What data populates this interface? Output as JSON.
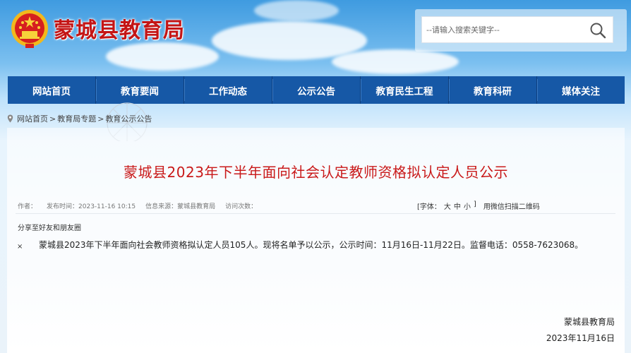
{
  "header": {
    "site_title": "蒙城县教育局",
    "logo_icon": "national-emblem-icon",
    "search": {
      "placeholder": "--请输入搜索关键字--",
      "button_icon": "search-icon"
    }
  },
  "nav": {
    "items": [
      {
        "label": "网站首页"
      },
      {
        "label": "教育要闻"
      },
      {
        "label": "工作动态"
      },
      {
        "label": "公示公告"
      },
      {
        "label": "教育民生工程"
      },
      {
        "label": "教育科研"
      },
      {
        "label": "媒体关注"
      }
    ],
    "bg_color": "#1658a6"
  },
  "breadcrumb": {
    "icon": "location-pin-icon",
    "items": [
      "网站首页",
      "教育局专题",
      "教育公示公告"
    ],
    "separator": ">"
  },
  "article": {
    "title": "蒙城县2023年下半年面向社会认定教师资格拟认定人员公示",
    "title_color": "#c91919",
    "meta": {
      "author": "作者：",
      "publish_time": "发布时间：2023-11-16 10:15",
      "source": "信息来源：蒙城县教育局",
      "views": "访问次数："
    },
    "font_size": {
      "label_open": "[字体：",
      "large": "大",
      "medium": "中",
      "small": "小",
      "label_close": "]"
    },
    "wechat": "用微信扫描二维码",
    "share": "分享至好友和朋友圈",
    "close": "×",
    "body": "蒙城县2023年下半年面向社会教师资格拟认定人员105人。现将名单予以公示，公示时间：11月16日-11月22日。监督电话：0558-7623068。",
    "sign_org": "蒙城县教育局",
    "sign_date": "2023年11月16日"
  }
}
